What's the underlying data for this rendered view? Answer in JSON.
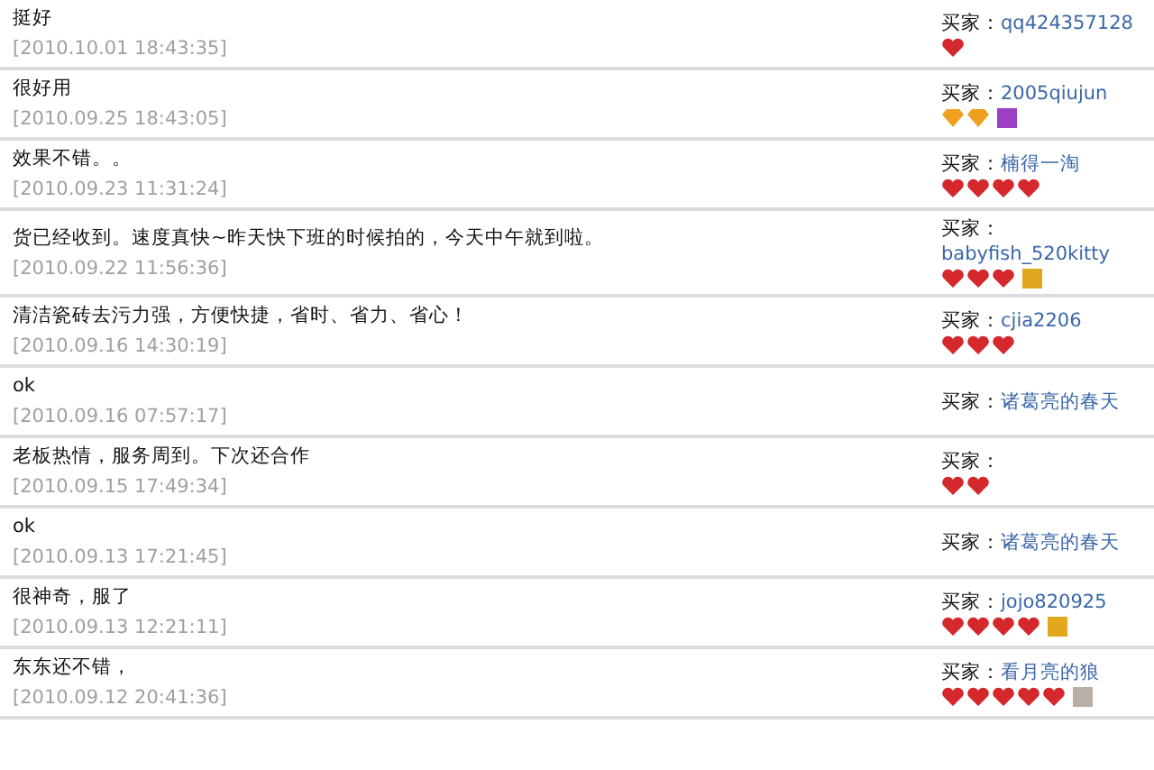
{
  "reviews": [
    {
      "comment": "挺好",
      "time": "[2010.10.01 18:43:35]",
      "buyer_label": "买家：",
      "buyer": "qq424357128",
      "rank": [
        {
          "kind": "heart"
        }
      ]
    },
    {
      "comment": "很好用",
      "time": "[2010.09.25 18:43:05]",
      "buyer_label": "买家：",
      "buyer": "2005qiujun",
      "rank": [
        {
          "kind": "diamond"
        },
        {
          "kind": "diamond"
        },
        {
          "kind": "badge",
          "color": "#9b3fc4"
        }
      ]
    },
    {
      "comment": "效果不错。。",
      "time": "[2010.09.23 11:31:24]",
      "buyer_label": "买家：",
      "buyer": "楠得一淘",
      "rank": [
        {
          "kind": "heart"
        },
        {
          "kind": "heart"
        },
        {
          "kind": "heart"
        },
        {
          "kind": "heart"
        }
      ]
    },
    {
      "comment": "货已经收到。速度真快~昨天快下班的时候拍的，今天中午就到啦。",
      "time": "[2010.09.22 11:56:36]",
      "buyer_label": "买家：",
      "buyer": "babyfish_520kitty",
      "rank": [
        {
          "kind": "heart"
        },
        {
          "kind": "heart"
        },
        {
          "kind": "heart"
        },
        {
          "kind": "badge",
          "color": "#e0a81c"
        }
      ]
    },
    {
      "comment": "清洁瓷砖去污力强，方便快捷，省时、省力、省心！",
      "time": "[2010.09.16 14:30:19]",
      "buyer_label": "买家：",
      "buyer": "cjia2206",
      "rank": [
        {
          "kind": "heart"
        },
        {
          "kind": "heart"
        },
        {
          "kind": "heart"
        }
      ]
    },
    {
      "comment": "ok",
      "time": "[2010.09.16 07:57:17]",
      "buyer_label": "买家：",
      "buyer": "诸葛亮的春天"
    },
    {
      "comment": "老板热情，服务周到。下次还合作",
      "time": "[2010.09.15 17:49:34]",
      "buyer_label": "买家：",
      "rank": [
        {
          "kind": "heart"
        },
        {
          "kind": "heart"
        }
      ]
    },
    {
      "comment": "ok",
      "time": "[2010.09.13 17:21:45]",
      "buyer_label": "买家：",
      "buyer": "诸葛亮的春天"
    },
    {
      "comment": "很神奇，服了",
      "time": "[2010.09.13 12:21:11]",
      "buyer_label": "买家：",
      "buyer": "jojo820925",
      "rank": [
        {
          "kind": "heart"
        },
        {
          "kind": "heart"
        },
        {
          "kind": "heart"
        },
        {
          "kind": "heart"
        },
        {
          "kind": "badge",
          "color": "#e0a81c"
        }
      ]
    },
    {
      "comment": "东东还不错，",
      "time": "[2010.09.12 20:41:36]",
      "buyer_label": "买家：",
      "buyer": "看月亮的狼",
      "rank": [
        {
          "kind": "heart"
        },
        {
          "kind": "heart"
        },
        {
          "kind": "heart"
        },
        {
          "kind": "heart"
        },
        {
          "kind": "heart"
        },
        {
          "kind": "badge",
          "color": "#b8b0a8"
        }
      ]
    }
  ]
}
